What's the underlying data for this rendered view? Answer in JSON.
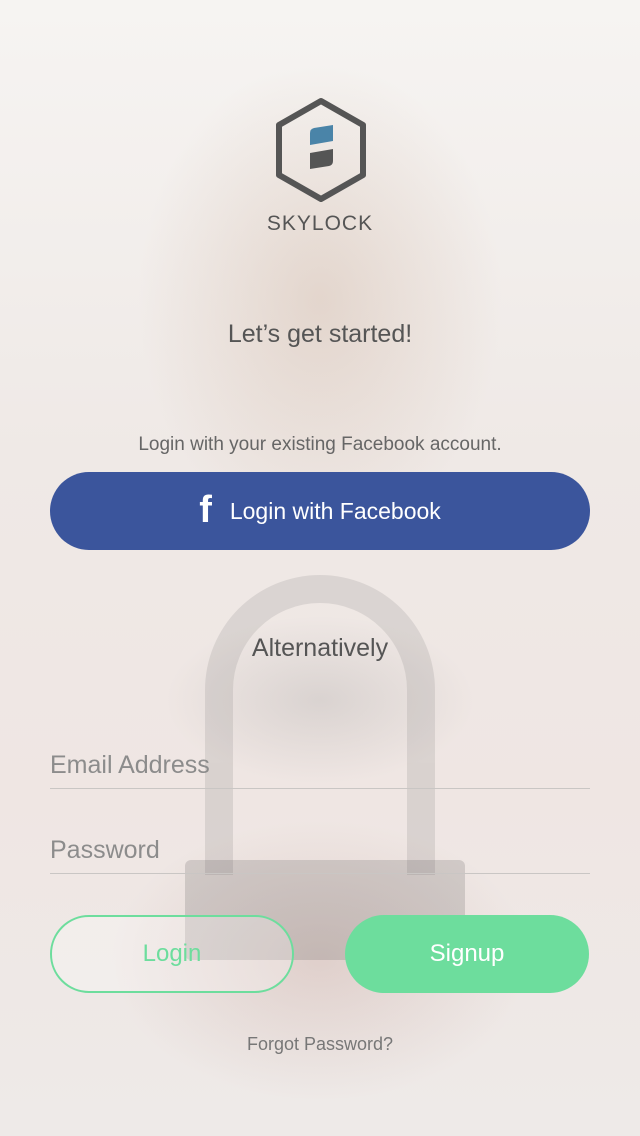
{
  "brand": {
    "name": "SKYLOCK",
    "logo_icon": "skylock-hexagon-logo-icon",
    "colors": {
      "primary_gray": "#555555",
      "accent_blue": "#4a84a8"
    }
  },
  "intro": {
    "headline": "Let’s get started!",
    "facebook_note": "Login with your existing Facebook account."
  },
  "facebook": {
    "button_label": "Login with Facebook",
    "icon": "facebook-f-icon",
    "icon_glyph": "f",
    "color": "#3b559c"
  },
  "alternative_label": "Alternatively",
  "form": {
    "email_placeholder": "Email Address",
    "email_value": "",
    "password_placeholder": "Password",
    "password_value": ""
  },
  "actions": {
    "login_label": "Login",
    "signup_label": "Signup",
    "accent_color": "#6ddd9d",
    "forgot_password_label": "Forgot Password?"
  }
}
